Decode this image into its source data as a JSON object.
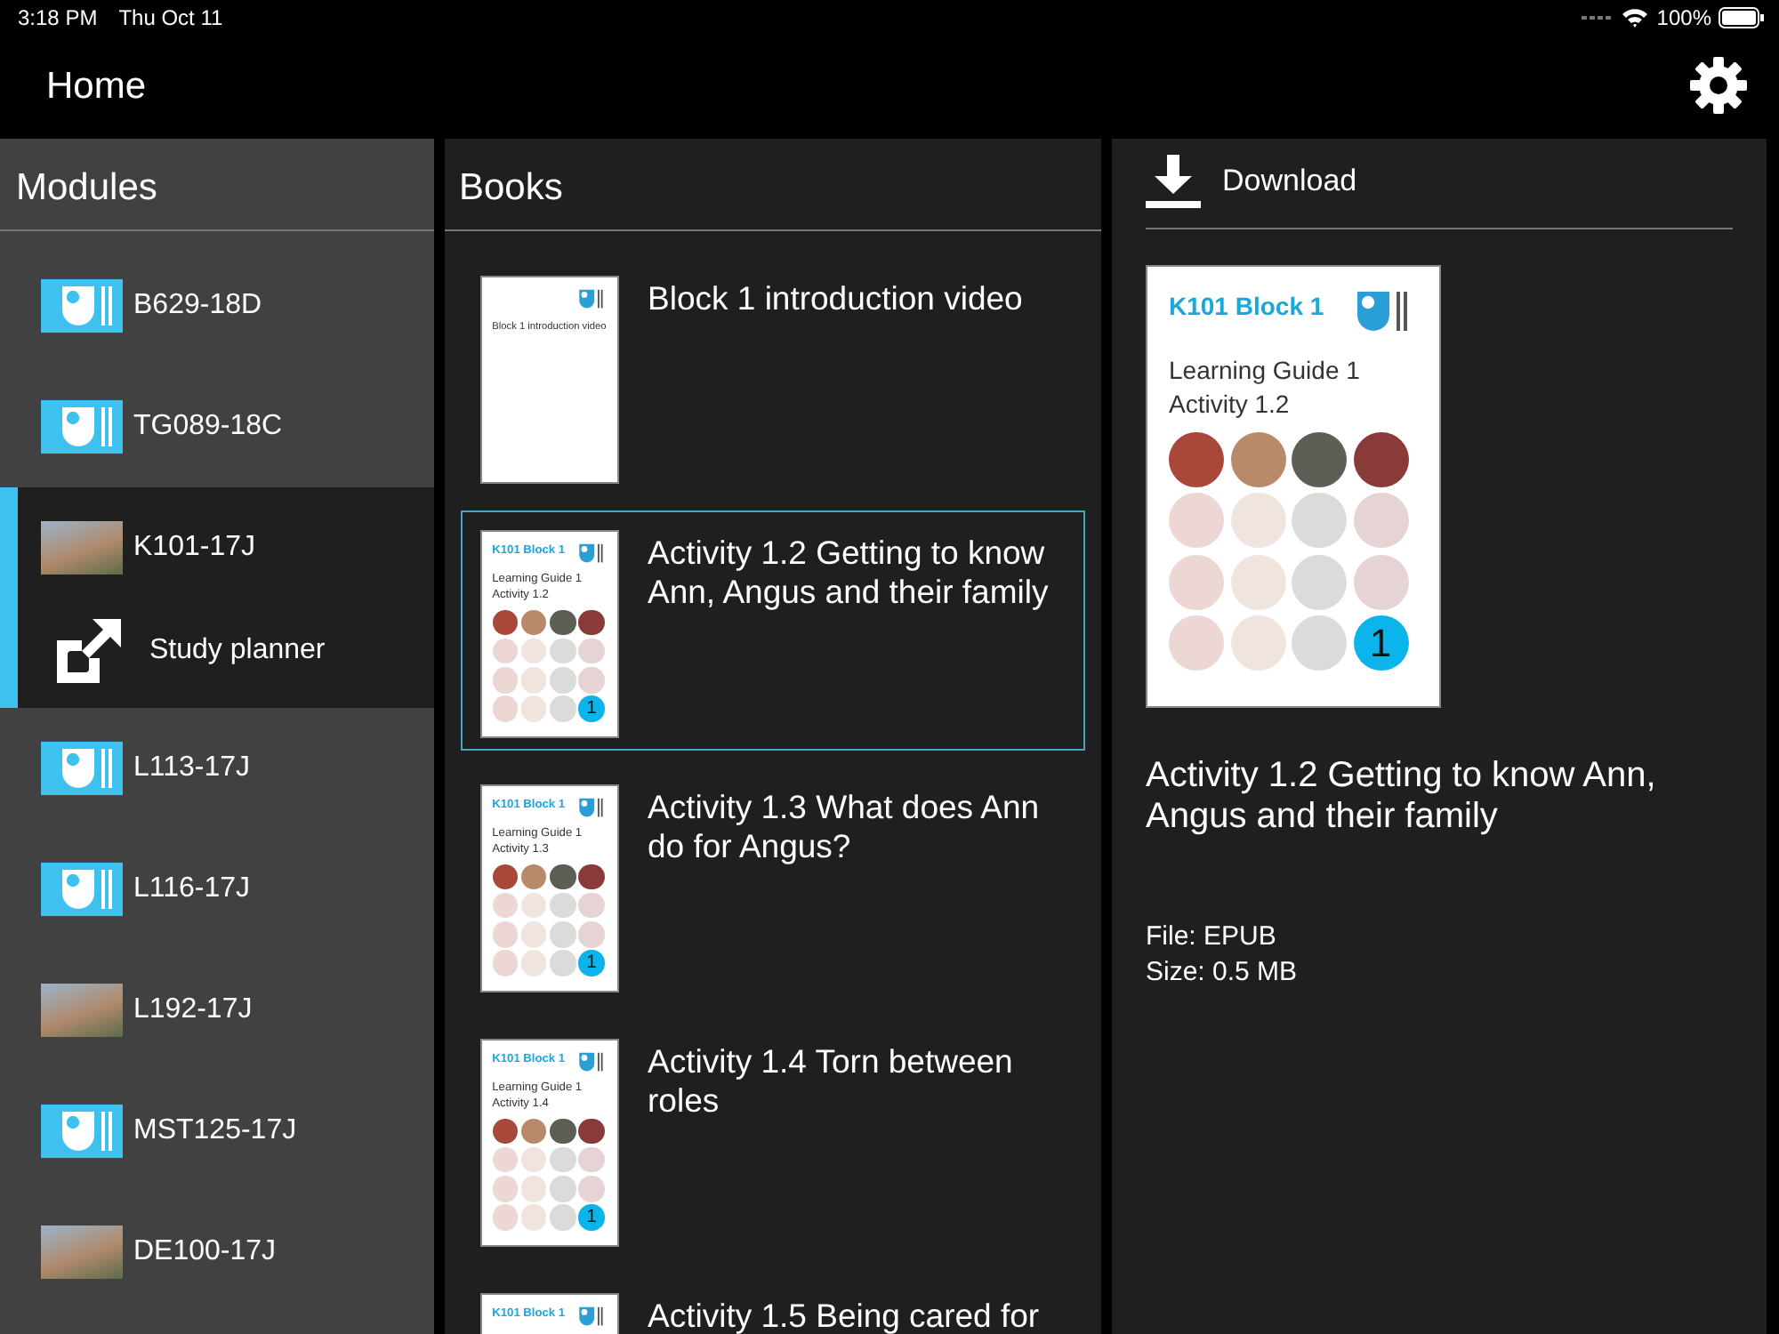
{
  "status_bar": {
    "time": "3:18 PM",
    "date": "Thu Oct 11",
    "battery": "100%"
  },
  "header": {
    "title": "Home"
  },
  "modules": {
    "title": "Modules",
    "items": [
      {
        "code": "B629-18D",
        "kind": "logo",
        "selected": false
      },
      {
        "code": "TG089-18C",
        "kind": "logo",
        "selected": false
      },
      {
        "code": "K101-17J",
        "kind": "photo",
        "selected": true,
        "subitems": [
          {
            "label": "Study planner"
          }
        ]
      },
      {
        "code": "L113-17J",
        "kind": "logo",
        "selected": false
      },
      {
        "code": "L116-17J",
        "kind": "logo",
        "selected": false
      },
      {
        "code": "L192-17J",
        "kind": "photo",
        "selected": false
      },
      {
        "code": "MST125-17J",
        "kind": "logo",
        "selected": false
      },
      {
        "code": "DE100-17J",
        "kind": "photo",
        "selected": false
      }
    ]
  },
  "books": {
    "title": "Books",
    "items": [
      {
        "title": "Block 1 introduction video",
        "selected": false,
        "cover": {
          "kind": "plain",
          "lines": [
            "Block 1 introduction video"
          ]
        }
      },
      {
        "title": "Activity 1.2 Getting to know Ann, Angus and their family",
        "selected": true,
        "cover": {
          "kind": "guide",
          "series": "K101 Block 1",
          "lines": [
            "Learning Guide 1",
            "Activity 1.2"
          ],
          "badge": "1"
        }
      },
      {
        "title": "Activity 1.3 What does Ann do for Angus?",
        "selected": false,
        "cover": {
          "kind": "guide",
          "series": "K101 Block 1",
          "lines": [
            "Learning Guide 1",
            "Activity 1.3"
          ],
          "badge": "1"
        }
      },
      {
        "title": "Activity 1.4 Torn between roles",
        "selected": false,
        "cover": {
          "kind": "guide",
          "series": "K101 Block 1",
          "lines": [
            "Learning Guide 1",
            "Activity 1.4"
          ],
          "badge": "1"
        }
      },
      {
        "title": "Activity 1.5 Being cared for",
        "selected": false,
        "cover": {
          "kind": "guide",
          "series": "K101 Block 1"
        }
      }
    ]
  },
  "detail": {
    "action": "Download",
    "cover": {
      "kind": "guide",
      "series": "K101 Block 1",
      "lines": [
        "Learning Guide 1",
        "Activity 1.2"
      ],
      "badge": "1"
    },
    "title": "Activity 1.2 Getting to know Ann, Angus and their family",
    "file": "File: EPUB",
    "size": "Size: 0.5 MB"
  }
}
